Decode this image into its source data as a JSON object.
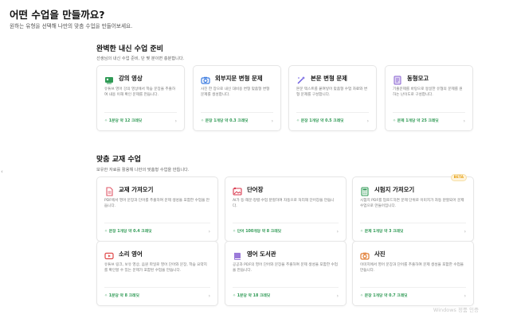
{
  "header": {
    "title": "어떤 수업을 만들까요?",
    "subtitle": "원하는 유형을 선택해 나만의 맞춤 수업을 만들어보세요."
  },
  "sections": [
    {
      "title": "완벽한 내신 수업 준비",
      "description": "선생님의 내신 수업 준비, 단 몇 분이면 충분합니다.",
      "cards": [
        {
          "title": "강의 영상",
          "icon": "video-lecture-icon",
          "accent": "#2f9a55",
          "desc": "유튜브 영어 강의 영상에서 학습 문장을 추출하여 내용 이해 확인 문제를 만듭니다.",
          "cost": "1분당 약 12 크레딧"
        },
        {
          "title": "외부지문 변형 문제",
          "icon": "camera-icon",
          "accent": "#3b7be0",
          "desc": "사진 한 장으로 내신 대비용 변형 맞춤형 변형 문제를 생성합니다.",
          "cost": "문장 1개당 약 0.3 크레딧"
        },
        {
          "title": "본문 변형 문제",
          "icon": "magic-wand-icon",
          "accent": "#6a5ae0",
          "desc": "본문 텍스트를 붙여넣어 맞춤형 수업 자료와 변형 문제를 구성합니다.",
          "cost": "문장 1개당 약 0.5 크레딧"
        },
        {
          "title": "동형모고",
          "icon": "document-icon",
          "accent": "#8a63d2",
          "desc": "기출문제를 바탕으로 동일한 유형의 문제를 원하는 난이도로 구성합니다.",
          "cost": "문제 1개당 약 25 크레딧"
        }
      ]
    },
    {
      "title": "맞춤 교재 수업",
      "description": "보유한 자료를 활용해 나만의 맞춤형 수업을 만듭니다.",
      "cards": [
        {
          "title": "교재 가져오기",
          "icon": "file-icon",
          "accent": "#e05a6a",
          "desc": "PDF에서 영어 문장과 단어를 추출하여 문제 생성을 포함한 수업을 만듭니다.",
          "cost": "문장 1개당 약 0.4 크레딧"
        },
        {
          "title": "단어장",
          "icon": "image-frame-icon",
          "accent": "#d9394e",
          "desc": "AI가 등·해문·정렬·수업 분할하여 자동으로 처리해 단어장을 만듭니다.",
          "cost": "단어 100개당 약 8 크레딧"
        },
        {
          "title": "시험지 가져오기",
          "icon": "calculator-icon",
          "accent": "#2f9a55",
          "desc": "시험지 PDF를 업로드하면 문제 단위로 이미지가 자동 분할되어 문제 수업으로 만들어집니다.",
          "cost": "문제 1개당 약 3 크레딧",
          "badge": "BETA"
        },
        {
          "title": "소리 영어",
          "icon": "play-icon",
          "accent": "#e04848",
          "desc": "유튜브 링크, 보유 영상, 음원 파일로 영어 단어와 문장, 학습 요약지를 확인할 수 있는 문제가 포함된 수업을 만듭니다.",
          "cost": "1분당 약 8 크레딧"
        },
        {
          "title": "영어 도서관",
          "icon": "book-icon",
          "accent": "#8a63d2",
          "desc": "공공과 PDF의 영어 단어와 문장을 추출하여 문제 생성을 포함한 수업을 만듭니다.",
          "cost": "1분당 약 18 크레딧"
        },
        {
          "title": "사진",
          "icon": "camera-icon",
          "accent": "#e07a2f",
          "desc": "이미지에서 영어 문장과 단어를 추출하여 문제 생성을 포함한 수업을 만듭니다.",
          "cost": "문장 1개당 약 0.7 크레딧"
        }
      ]
    }
  ],
  "watermark": "Windows 정품 인증"
}
